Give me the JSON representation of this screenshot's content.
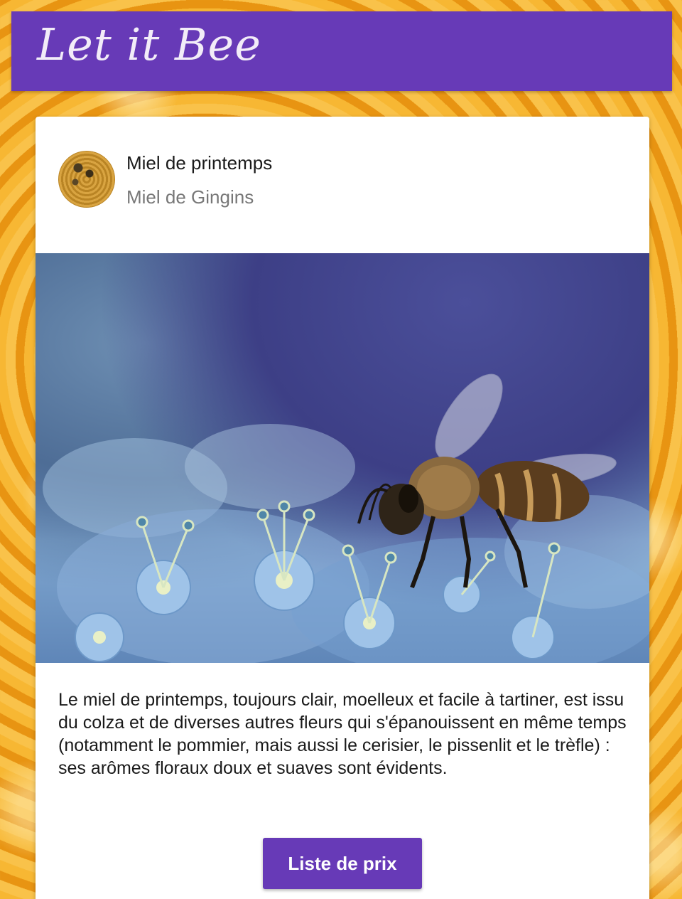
{
  "header": {
    "title": "Let it Bee",
    "background_color": "#673ab7"
  },
  "card": {
    "title": "Miel de printemps",
    "subtitle": "Miel de Gingins",
    "avatar_icon": "honeycomb-avatar",
    "image_subject": "bee-on-blue-hydrangea-photo",
    "description": "Le miel de printemps, toujours clair, moelleux et facile à tartiner, est issu du colza et de diverses autres fleurs qui s'épanouissent en même temps (notamment le pommier, mais aussi le cerisier, le pissenlit et le trèfle) : ses arômes floraux doux et suaves sont évidents.",
    "button_label": "Liste de prix",
    "button_color": "#673ab7"
  }
}
